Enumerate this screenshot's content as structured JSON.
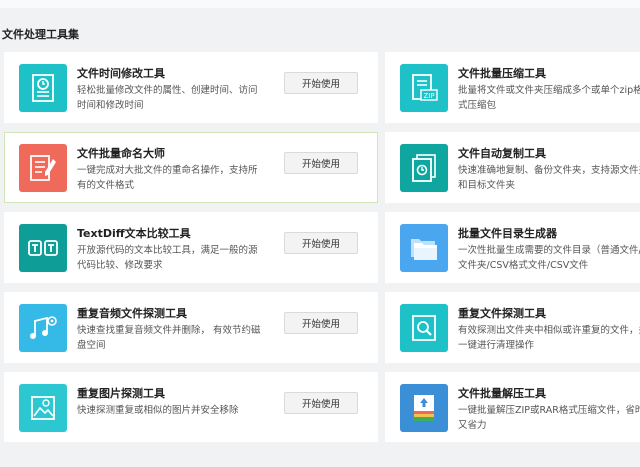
{
  "section_title": "文件处理工具集",
  "action_label": "开始使用",
  "colors": {
    "page_bg": "#f1f2f4",
    "card_bg": "#ffffff",
    "highlight_border": "#cfe6b8",
    "teal": "#1fc1c9",
    "red": "#ef6a5b",
    "dark_teal": "#0f9e97",
    "blue": "#4aa7ef",
    "button_bg": "#f3f3f3"
  },
  "tools_left": [
    {
      "name": "文件时间修改工具",
      "desc": "轻松批量修改文件的属性、创建时间、访问时间和修改时间",
      "icon": "clock-document-icon"
    },
    {
      "name": "文件批量命名大师",
      "desc": "一键完成对大批文件的重命名操作，支持所有的文件格式",
      "icon": "edit-document-icon"
    },
    {
      "name": "TextDiff文本比较工具",
      "desc": "开放源代码的文本比较工具，满足一般的源代码比较、修改要求",
      "icon": "text-compare-icon"
    },
    {
      "name": "重复音频文件探测工具",
      "desc": "快速查找重复音频文件并删除， 有效节约磁盘空间",
      "icon": "music-search-icon"
    },
    {
      "name": "重复图片探测工具",
      "desc": "快速探测重复或相似的图片并安全移除",
      "icon": "image-search-icon"
    }
  ],
  "tools_right": [
    {
      "name": "文件批量压缩工具",
      "desc": "批量将文件或文件夹压缩成多个或单个zip格式压缩包",
      "icon": "zip-document-icon"
    },
    {
      "name": "文件自动复制工具",
      "desc": "快速准确地复制、备份文件夹，支持源文件夹和目标文件夹",
      "icon": "copy-folder-icon"
    },
    {
      "name": "批量文件目录生成器",
      "desc": "一次性批量生成需要的文件目录（普通文件/文件夹/CSV格式文件/CSV文件",
      "icon": "folders-icon"
    },
    {
      "name": "重复文件探测工具",
      "desc": "有效探测出文件夹中相似或许重复的文件，并一键进行清理操作",
      "icon": "file-search-icon"
    },
    {
      "name": "文件批量解压工具",
      "desc": "一键批量解压ZIP或RAR格式压缩文件，省时又省力",
      "icon": "unzip-archive-icon"
    }
  ]
}
